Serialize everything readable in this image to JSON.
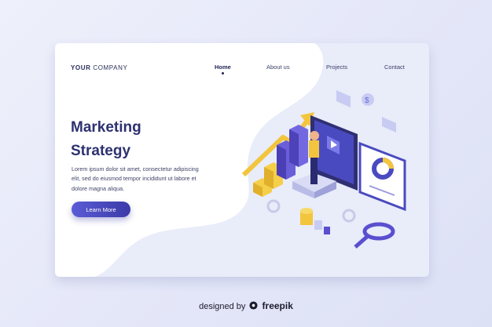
{
  "brand": {
    "bold": "YOUR",
    "rest": " COMPANY"
  },
  "nav": {
    "items": [
      {
        "label": "Home",
        "active": true
      },
      {
        "label": "About us",
        "active": false
      },
      {
        "label": "Projects",
        "active": false
      },
      {
        "label": "Contact",
        "active": false
      }
    ]
  },
  "hero": {
    "title_line1": "Marketing",
    "title_line2": "Strategy",
    "desc_line1": "Lorem ipsum dolor sit amet, consectetur adipiscing",
    "desc_line2": "elit, sed do eiusmod tempor incididunt ut labore et",
    "desc_line3": "dolore magna aliqua.",
    "cta_label": "Learn More"
  },
  "footer": {
    "prefix": "designed by",
    "brand": "freepik"
  },
  "colors": {
    "accent": "#4b4bc8",
    "title": "#2d3170",
    "bar_yellow": "#f2c53d",
    "bar_purple": "#5a4fcf"
  }
}
